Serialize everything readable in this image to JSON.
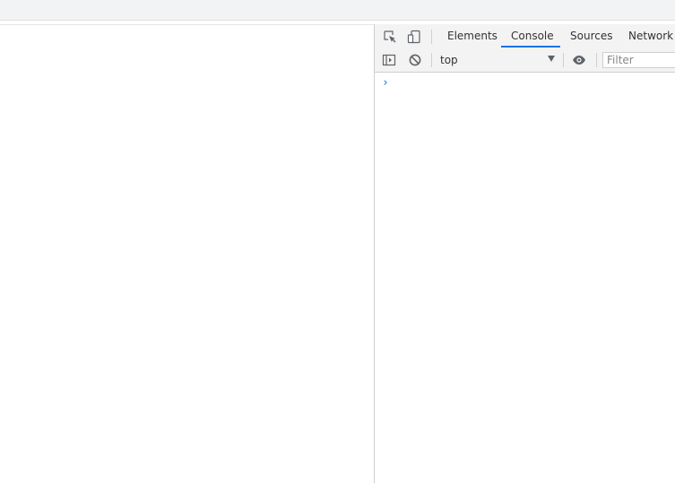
{
  "devtools": {
    "tabs": [
      {
        "label": "Elements",
        "active": false
      },
      {
        "label": "Console",
        "active": true
      },
      {
        "label": "Sources",
        "active": false
      },
      {
        "label": "Network",
        "active": false
      }
    ],
    "toolbar_icons": [
      "inspect-element-icon",
      "device-toggle-icon"
    ],
    "accent_color": "#1a73e8"
  },
  "console": {
    "sidebar_icon": "sidebar-toggle-icon",
    "clear_icon": "clear-console-icon",
    "context": "top",
    "eye_icon": "live-expression-icon",
    "filter_placeholder": "Filter",
    "prompt_glyph": "›"
  }
}
